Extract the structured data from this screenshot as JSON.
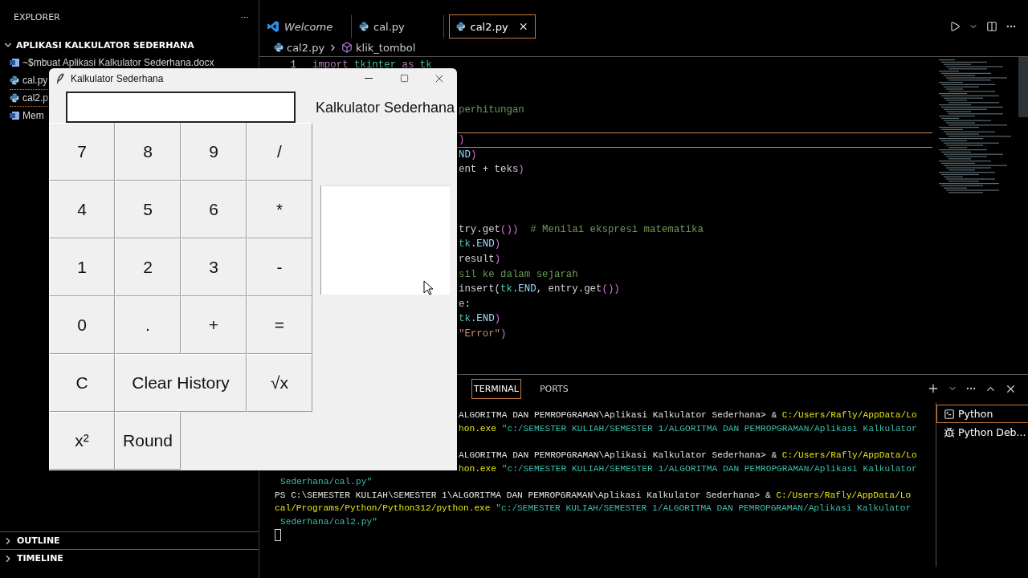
{
  "sidebar": {
    "title": "EXPLORER",
    "more": "···",
    "folder": {
      "label": "APLIKASI KALKULATOR SEDERHANA",
      "expanded": true,
      "items": [
        {
          "label": "~$mbuat Aplikasi Kalkulator Sederhana.docx",
          "kind": "doc",
          "selected": false
        },
        {
          "label": "cal.py",
          "kind": "python",
          "selected": false
        },
        {
          "label": "cal2.p",
          "kind": "python",
          "selected": true
        },
        {
          "label": "Mem",
          "kind": "doc",
          "selected": false
        }
      ]
    },
    "sections": [
      {
        "label": "OUTLINE",
        "expanded": false
      },
      {
        "label": "TIMELINE",
        "expanded": false
      }
    ]
  },
  "editor": {
    "tabs": [
      {
        "label": "Welcome",
        "kind": "welcome",
        "selected": false
      },
      {
        "label": "cal.py",
        "kind": "python",
        "selected": false
      },
      {
        "label": "cal2.py",
        "kind": "python",
        "selected": true
      }
    ],
    "breadcrumbs": [
      "cal2.py",
      "klik_tombol"
    ],
    "lines": [
      {
        "number": "1",
        "kind": "full",
        "current": false,
        "tokens": [
          {
            "text": "import",
            "kind": "keyword"
          },
          {
            "text": " tkinter ",
            "kind": "module"
          },
          {
            "text": "as",
            "kind": "keyword"
          },
          {
            "text": " tk",
            "kind": "module"
          }
        ]
      },
      {
        "current": false
      },
      {
        "current": false
      },
      {
        "kind": "clipped",
        "current": false,
        "tokens": [
          {
            "text": "perhitungan",
            "kind": "comment"
          }
        ]
      },
      {
        "current": false
      },
      {
        "kind": "clipped",
        "current": true,
        "tokens": [
          {
            "text": ")",
            "kind": "bracket"
          }
        ]
      },
      {
        "kind": "clipped",
        "current": false,
        "tokens": [
          {
            "text": "ND",
            "kind": "constant"
          },
          {
            "text": ")",
            "kind": "bracket"
          }
        ]
      },
      {
        "kind": "clipped",
        "current": false,
        "tokens": [
          {
            "text": "ent + teks",
            "kind": "plain"
          },
          {
            "text": ")",
            "kind": "bracket"
          }
        ]
      },
      {
        "current": false
      },
      {
        "current": false
      },
      {
        "current": false
      },
      {
        "kind": "clipped",
        "current": false,
        "tokens": [
          {
            "text": "try.get",
            "kind": "plain"
          },
          {
            "text": "())",
            "kind": "bracket"
          },
          {
            "text": "  # Menilai ekspresi matematika",
            "kind": "comment"
          }
        ]
      },
      {
        "kind": "clipped",
        "current": false,
        "tokens": [
          {
            "text": "tk",
            "kind": "module"
          },
          {
            "text": ".END",
            "kind": "constant"
          },
          {
            "text": ")",
            "kind": "bracket"
          }
        ]
      },
      {
        "kind": "clipped",
        "current": false,
        "tokens": [
          {
            "text": "result",
            "kind": "plain"
          },
          {
            "text": ")",
            "kind": "bracket"
          }
        ]
      },
      {
        "kind": "clipped",
        "current": false,
        "tokens": [
          {
            "text": "sil ke dalam sejarah",
            "kind": "comment"
          }
        ]
      },
      {
        "kind": "clipped",
        "current": false,
        "tokens": [
          {
            "text": "insert(",
            "kind": "plain"
          },
          {
            "text": "tk",
            "kind": "module"
          },
          {
            "text": ".END",
            "kind": "constant"
          },
          {
            "text": ", entry.get",
            "kind": "plain"
          },
          {
            "text": "())",
            "kind": "bracket"
          }
        ]
      },
      {
        "kind": "clipped",
        "current": false,
        "tokens": [
          {
            "text": "e:",
            "kind": "plain"
          }
        ]
      },
      {
        "kind": "clipped",
        "current": false,
        "tokens": [
          {
            "text": "tk",
            "kind": "module"
          },
          {
            "text": ".END",
            "kind": "constant"
          },
          {
            "text": ")",
            "kind": "bracket"
          }
        ]
      },
      {
        "kind": "clipped",
        "current": false,
        "tokens": [
          {
            "text": "\"Error\"",
            "kind": "string"
          },
          {
            "text": ")",
            "kind": "bracket"
          }
        ]
      }
    ]
  },
  "panel": {
    "tabs": [
      {
        "label": "TERMINAL",
        "selected": true
      },
      {
        "label": "PORTS",
        "selected": false
      }
    ],
    "terminal_lines": [
      {
        "kind": "clipped",
        "tokens": [
          {
            "text": "ALGORITMA DAN PEMROPGRAMAN\\Aplikasi Kalkulator Sederhana> & ",
            "kind": "plain"
          },
          {
            "text": "C:/Users/Rafly/AppData/Lo",
            "kind": "path"
          }
        ]
      },
      {
        "kind": "clipped",
        "tokens": [
          {
            "text": "hon.exe ",
            "kind": "path"
          },
          {
            "text": "\"c:/SEMESTER KULIAH/SEMESTER 1/ALGORITMA DAN PEMROPGRAMAN/Aplikasi Kalkulator",
            "kind": "string"
          }
        ]
      },
      {
        "kind": "blank"
      },
      {
        "kind": "clipped",
        "tokens": [
          {
            "text": "ALGORITMA DAN PEMROPGRAMAN\\Aplikasi Kalkulator Sederhana> & ",
            "kind": "plain"
          },
          {
            "text": "C:/Users/Rafly/AppData/Lo",
            "kind": "path"
          }
        ]
      },
      {
        "kind": "clipped",
        "tokens": [
          {
            "text": "hon.exe ",
            "kind": "path"
          },
          {
            "text": "\"c:/SEMESTER KULIAH/SEMESTER 1/ALGORITMA DAN PEMROPGRAMAN/Aplikasi Kalkulator",
            "kind": "string"
          }
        ]
      },
      {
        "kind": "continuation",
        "tokens": [
          {
            "text": "Sederhana/cal.py\"",
            "kind": "string"
          }
        ]
      },
      {
        "kind": "full",
        "tokens": [
          {
            "text": "PS C:\\SEMESTER KULIAH\\SEMESTER 1\\ALGORITMA DAN PEMROPGRAMAN\\Aplikasi Kalkulator Sederhana> & ",
            "kind": "plain"
          },
          {
            "text": "C:/Users/Rafly/AppData/Lo",
            "kind": "path"
          }
        ]
      },
      {
        "kind": "full",
        "tokens": [
          {
            "text": "cal/Programs/Python/Python312/python.exe ",
            "kind": "path"
          },
          {
            "text": "\"c:/SEMESTER KULIAH/SEMESTER 1/ALGORITMA DAN PEMROPGRAMAN/Aplikasi Kalkulator",
            "kind": "string"
          }
        ]
      },
      {
        "kind": "continuation",
        "tokens": [
          {
            "text": "Sederhana/cal2.py\"",
            "kind": "string"
          }
        ]
      },
      {
        "kind": "cursor"
      }
    ],
    "terminals": [
      {
        "label": "Python",
        "kind": "shell",
        "selected": true
      },
      {
        "label": "Python Deb...",
        "kind": "debug",
        "selected": false
      }
    ]
  },
  "calculator": {
    "title": "Kalkulator Sederhana",
    "heading": "Kalkulator Sederhana",
    "buttons": [
      {
        "label": "7",
        "kind": "normal"
      },
      {
        "label": "8",
        "kind": "normal"
      },
      {
        "label": "9",
        "kind": "normal"
      },
      {
        "label": "/",
        "kind": "normal"
      },
      {
        "label": "4",
        "kind": "normal"
      },
      {
        "label": "5",
        "kind": "normal"
      },
      {
        "label": "6",
        "kind": "normal"
      },
      {
        "label": "*",
        "kind": "normal"
      },
      {
        "label": "1",
        "kind": "normal"
      },
      {
        "label": "2",
        "kind": "normal"
      },
      {
        "label": "3",
        "kind": "normal"
      },
      {
        "label": "-",
        "kind": "normal"
      },
      {
        "label": "0",
        "kind": "normal"
      },
      {
        "label": ".",
        "kind": "normal"
      },
      {
        "label": "+",
        "kind": "normal"
      },
      {
        "label": "=",
        "kind": "normal"
      },
      {
        "label": "C",
        "kind": "normal"
      },
      {
        "label": "Clear History",
        "kind": "wide"
      },
      {
        "label": "√x",
        "kind": "normal"
      },
      {
        "label": "x²",
        "kind": "normal"
      },
      {
        "label": "Round",
        "kind": "normal"
      }
    ]
  }
}
